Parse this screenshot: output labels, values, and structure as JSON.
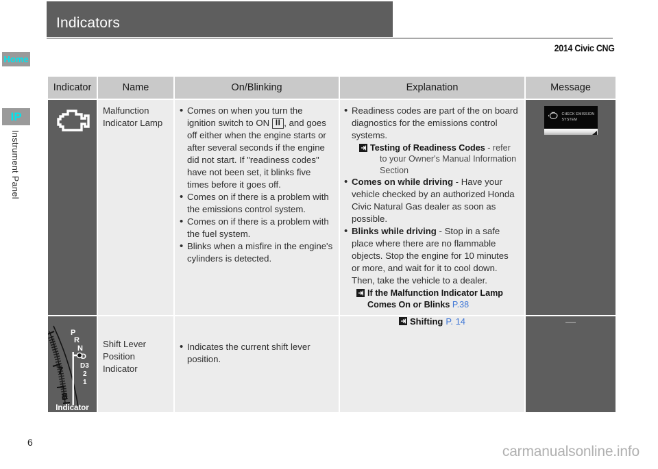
{
  "header": {
    "title": "Indicators",
    "model": "2014 Civic CNG"
  },
  "sidebar": {
    "home_label": "Home",
    "ip_label": "IP",
    "section_label": "Instrument Panel"
  },
  "table": {
    "columns": [
      "Indicator",
      "Name",
      "On/Blinking",
      "Explanation",
      "Message"
    ],
    "rows": [
      {
        "indicator_icon": "check-engine-icon",
        "name": "Malfunction Indicator Lamp",
        "on_blinking": [
          {
            "parts": [
              {
                "t": "Comes on when you turn the ignition switch to ON "
              },
              {
                "t": "II",
                "style": "keybox"
              },
              {
                "t": ", and goes off either when the engine starts or after several seconds if the engine did not start. If \"readiness codes\" have not been set, it blinks five times before it goes off."
              }
            ]
          },
          {
            "parts": [
              {
                "t": "Comes on if there is a problem with the emissions control system."
              }
            ]
          },
          {
            "parts": [
              {
                "t": "Comes on if there is a problem with the fuel system."
              }
            ]
          },
          {
            "parts": [
              {
                "t": "Blinks when a misfire in the engine's cylinders is detected."
              }
            ]
          }
        ],
        "explanation": [
          {
            "parts": [
              {
                "t": "Readiness codes are part of the on board diagnostics for the emissions control systems."
              }
            ],
            "ref": {
              "title": "Testing of Readiness Codes",
              "rest": " - refer",
              "indent": "to your Owner's Manual Information Section"
            }
          },
          {
            "parts": [
              {
                "t": "Comes on while driving",
                "style": "bold"
              },
              {
                "t": " - Have your vehicle checked by an authorized Honda Civic Natural Gas dealer as soon as possible."
              }
            ]
          },
          {
            "parts": [
              {
                "t": "Blinks while driving",
                "style": "bold"
              },
              {
                "t": " - Stop in a safe place where there are no flammable objects. Stop the engine for 10 minutes or more, and wait for it to cool down. Then, take the vehicle to a dealer."
              }
            ],
            "ref": {
              "title": "If the Malfunction Indicator Lamp Comes On or Blinks",
              "page": "P.38"
            }
          }
        ],
        "message_screen": {
          "line1": "CHECK EMISSION",
          "line2": "SYSTEM"
        }
      },
      {
        "indicator_art": "shift-lever-gauge",
        "gauge": {
          "gears": [
            "P",
            "R",
            "N",
            "D",
            "D3",
            "2",
            "1"
          ],
          "tach_numbers": [
            "7",
            "8"
          ],
          "caption": "Indicator"
        },
        "name": "Shift Lever Position Indicator",
        "on_blinking": [
          {
            "parts": [
              {
                "t": "Indicates the current shift lever position."
              }
            ]
          }
        ],
        "explanation_ref": {
          "title": "Shifting",
          "page": "P. 14"
        },
        "message": "—"
      }
    ]
  },
  "footer": {
    "page_number": "6",
    "watermark": "carmanualsonline.info"
  },
  "colors": {
    "header_bar": "#5e5e5e",
    "table_header": "#c9c9c9",
    "cell_bg": "#ececec",
    "dark_cell": "#5e5e5e",
    "accent_cyan": "#00e5ee",
    "link_blue": "#3f77d6"
  }
}
